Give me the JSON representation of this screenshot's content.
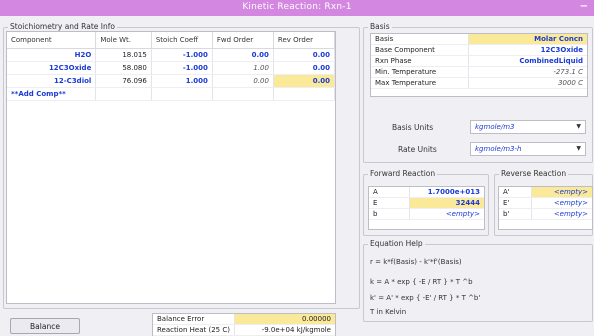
{
  "window": {
    "title": "Kinetic Reaction: Rxn-1",
    "minimize": "−"
  },
  "stoich": {
    "group_label": "Stoichiometry and Rate Info",
    "headers": [
      "Component",
      "Mole Wt.",
      "Stoich Coeff",
      "Fwd Order",
      "Rev Order"
    ],
    "rows": [
      {
        "name": "H2O",
        "mw": "18.015",
        "coeff": "-1.000",
        "fwd": "0.00",
        "rev": "0.00"
      },
      {
        "name": "12C3Oxide",
        "mw": "58.080",
        "coeff": "-1.000",
        "fwd": "1.00",
        "rev": "0.00"
      },
      {
        "name": "12-C3diol",
        "mw": "76.096",
        "coeff": "1.000",
        "fwd": "0.00",
        "rev": "0.00"
      }
    ],
    "add_comp": "**Add Comp**"
  },
  "balance": {
    "button": "Balance",
    "error_label": "Balance Error",
    "error_value": "0.00000",
    "heat_label": "Reaction Heat (25 C)",
    "heat_value": "-9.0e+04 kJ/kgmole"
  },
  "basis": {
    "group_label": "Basis",
    "rows": [
      {
        "k": "Basis",
        "v": "Molar Concn"
      },
      {
        "k": "Base Component",
        "v": "12C3Oxide"
      },
      {
        "k": "Rxn Phase",
        "v": "CombinedLiquid"
      },
      {
        "k": "Min. Temperature",
        "v": "-273.1 C"
      },
      {
        "k": "Max Temperature",
        "v": "3000 C"
      }
    ],
    "basis_units_label": "Basis Units",
    "basis_units_value": "kgmole/m3",
    "rate_units_label": "Rate Units",
    "rate_units_value": "kgmole/m3-h"
  },
  "forward": {
    "group_label": "Forward Reaction",
    "rows": [
      {
        "k": "A",
        "v": "1.7000e+013"
      },
      {
        "k": "E",
        "v": "32444"
      },
      {
        "k": "b",
        "v": "<empty>"
      }
    ]
  },
  "reverse": {
    "group_label": "Reverse Reaction",
    "rows": [
      {
        "k": "A'",
        "v": "<empty>"
      },
      {
        "k": "E'",
        "v": "<empty>"
      },
      {
        "k": "b'",
        "v": "<empty>"
      }
    ]
  },
  "help": {
    "group_label": "Equation Help",
    "lines": [
      "r = k*f(Basis) - k'*f'(Basis)",
      "k = A * exp { -E / RT } * T ^b",
      "k' = A' * exp { -E' / RT } * T ^b'",
      "T in Kelvin"
    ]
  },
  "colors": {
    "titlebar": "#d487e0",
    "highlight": "#fbe99a",
    "value_blue": "#1c3bd4"
  }
}
